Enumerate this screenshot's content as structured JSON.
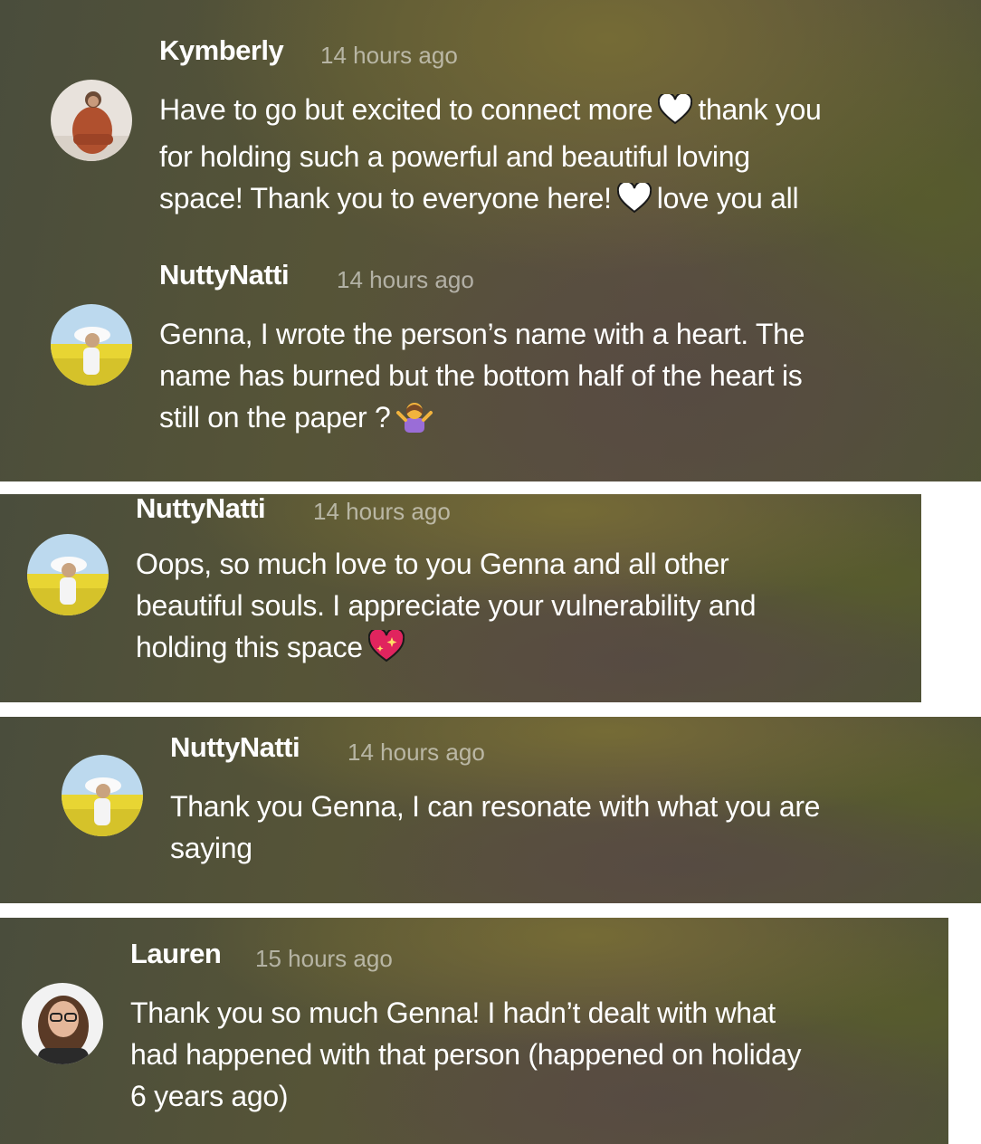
{
  "comments": [
    {
      "author": "Kymberly",
      "time": "14 hours ago",
      "lines": [
        {
          "a": "Have to go but excited to connect more",
          "emoji": "white-heart-icon",
          "b": "thank you"
        },
        {
          "a": "for holding such a powerful and beautiful loving"
        },
        {
          "a": "space! Thank you to everyone here!",
          "emoji": "white-heart-icon",
          "b": "love you all"
        }
      ]
    },
    {
      "author": "NuttyNatti",
      "time": "14 hours ago",
      "lines": [
        {
          "a": "Genna, I wrote the person’s name with a heart. The"
        },
        {
          "a": "name has burned but the bottom half of the heart is"
        },
        {
          "a": "still on the paper ?",
          "emoji": "person-shrugging-icon"
        }
      ]
    },
    {
      "author": "NuttyNatti",
      "time": "14 hours ago",
      "lines": [
        {
          "a": "Oops, so much love to you Genna and all other"
        },
        {
          "a": "beautiful souls. I appreciate your vulnerability and"
        },
        {
          "a": "holding this space",
          "emoji": "sparkling-heart-icon"
        }
      ]
    },
    {
      "author": "NuttyNatti",
      "time": "14 hours ago",
      "lines": [
        {
          "a": "Thank you Genna, I can resonate with what you are"
        },
        {
          "a": "saying"
        }
      ]
    },
    {
      "author": "Lauren",
      "time": "15 hours ago",
      "lines": [
        {
          "a": "Thank you so much Genna! I hadn’t dealt with what"
        },
        {
          "a": "had happened with that person (happened on holiday"
        },
        {
          "a": "6 years ago)"
        }
      ]
    }
  ]
}
